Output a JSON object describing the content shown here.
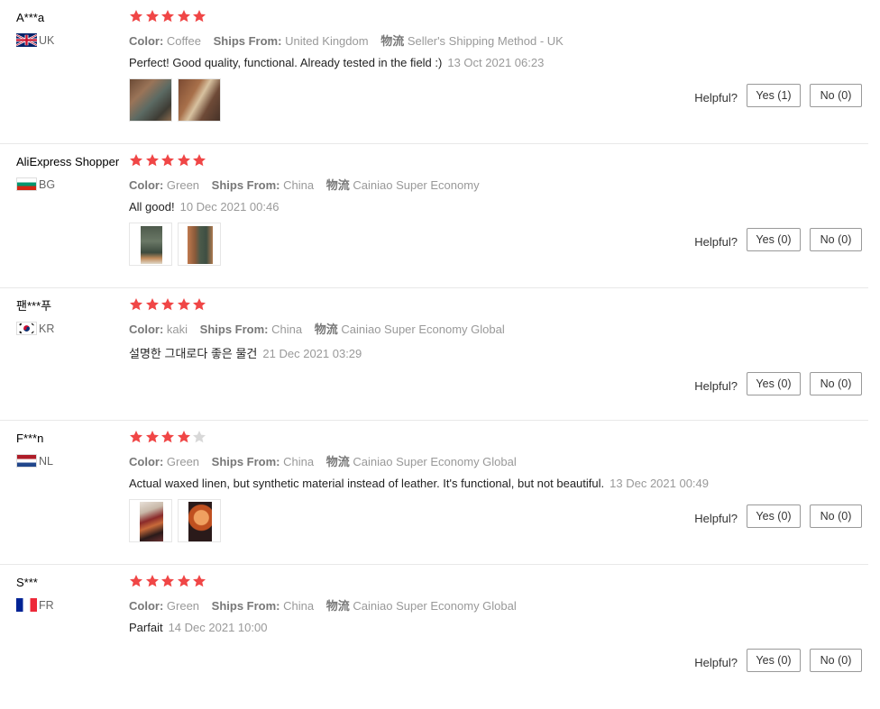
{
  "helpful_label": "Helpful?",
  "labels": {
    "color": "Color:",
    "ships_from": "Ships From:",
    "logistics": "物流"
  },
  "colors": {
    "star_on": "#f04646",
    "star_off": "#d8d8d8"
  },
  "reviews": [
    {
      "user": "A***a",
      "country_code": "UK",
      "flag": "uk",
      "rating": 5,
      "color": "Coffee",
      "ships_from": "United Kingdom",
      "logistics": "Seller's Shipping Method - UK",
      "text": "Perfect! Good quality, functional. Already tested in the field :)",
      "date": "13 Oct 2021 06:23",
      "photos": 2,
      "yes": "Yes (1)",
      "no": "No (0)"
    },
    {
      "user": "AliExpress Shopper",
      "country_code": "BG",
      "flag": "bg",
      "rating": 5,
      "color": "Green",
      "ships_from": "China",
      "logistics": "Cainiao Super Economy",
      "text": "All good!",
      "date": "10 Dec 2021 00:46",
      "photos": 2,
      "yes": "Yes (0)",
      "no": "No (0)"
    },
    {
      "user": "팬***푸",
      "country_code": "KR",
      "flag": "kr",
      "rating": 5,
      "color": "kaki",
      "ships_from": "China",
      "logistics": "Cainiao Super Economy Global",
      "text": "설명한 그대로다 좋은 물건",
      "date": "21 Dec 2021 03:29",
      "photos": 0,
      "yes": "Yes (0)",
      "no": "No (0)"
    },
    {
      "user": "F***n",
      "country_code": "NL",
      "flag": "nl",
      "rating": 4,
      "color": "Green",
      "ships_from": "China",
      "logistics": "Cainiao Super Economy Global",
      "text": "Actual waxed linen, but synthetic material instead of leather. It's functional, but not beautiful.",
      "date": "13 Dec 2021 00:49",
      "photos": 2,
      "yes": "Yes (0)",
      "no": "No (0)"
    },
    {
      "user": "S***",
      "country_code": "FR",
      "flag": "fr",
      "rating": 5,
      "color": "Green",
      "ships_from": "China",
      "logistics": "Cainiao Super Economy Global",
      "text": "Parfait",
      "date": "14 Dec 2021 10:00",
      "photos": 0,
      "yes": "Yes (0)",
      "no": "No (0)"
    }
  ]
}
